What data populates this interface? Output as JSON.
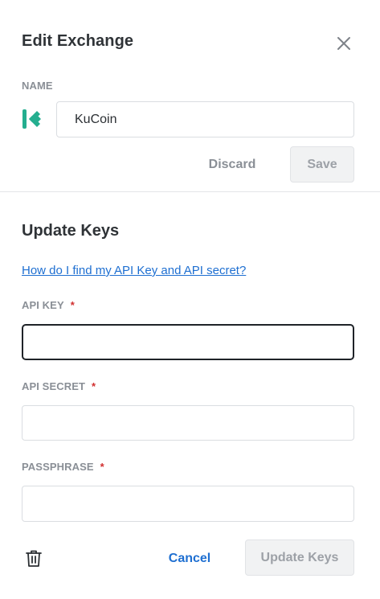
{
  "header": {
    "title": "Edit Exchange",
    "close_icon": "close-icon"
  },
  "name_section": {
    "label": "NAME",
    "logo_icon": "kucoin-logo",
    "value": "KuCoin",
    "discard_label": "Discard",
    "save_label": "Save"
  },
  "keys_section": {
    "title": "Update Keys",
    "help_link": "How do I find my API Key and API secret?",
    "api_key": {
      "label": "API KEY",
      "required_mark": "*",
      "value": ""
    },
    "api_secret": {
      "label": "API SECRET",
      "required_mark": "*",
      "value": ""
    },
    "passphrase": {
      "label": "PASSPHRASE",
      "required_mark": "*",
      "value": ""
    }
  },
  "footer": {
    "delete_icon": "trash-icon",
    "cancel_label": "Cancel",
    "update_label": "Update Keys"
  },
  "colors": {
    "link": "#1e6fd1",
    "required": "#d12f2f",
    "kucoin_brand": "#24ae8f",
    "focused_border": "#1f2328"
  }
}
